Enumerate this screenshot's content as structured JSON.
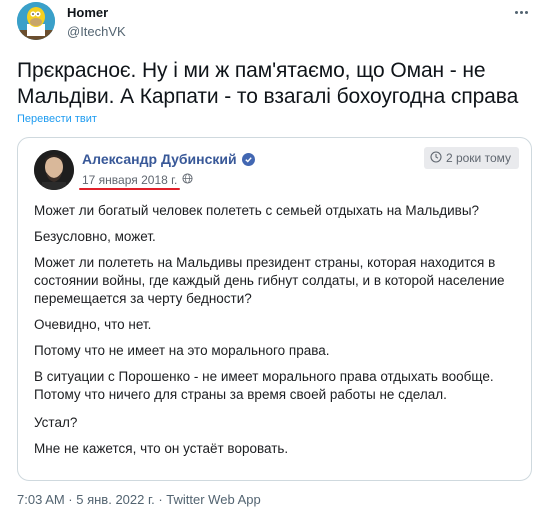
{
  "author": {
    "name": "Homer",
    "handle": "@ItechVK"
  },
  "tweet": {
    "text": "Прєкрасноє. Ну і ми ж пам'ятаємо, що Оман - не Мальдіви. А Карпати - то взагалі бохоугодна справа",
    "translate_label": "Перевести твит"
  },
  "embed": {
    "name": "Александр Дубинский",
    "date": "17 января 2018 г.",
    "time_ago": "2 роки тому",
    "paragraphs": [
      "Может ли богатый человек полететь с семьей отдыхать на Мальдивы?",
      "Безусловно, может.",
      "Может ли полететь на Мальдивы президент страны, которая находится в состоянии войны, где каждый день гибнут солдаты, и в которой население перемещается за черту бедности?",
      "Очевидно, что нет.",
      "Потому что не имеет на это морального права.",
      "В ситуации с Порошенко - не имеет морального права отдыхать вообще. Потому что ничего для страны за время своей работы не сделал.",
      "Устал?",
      "Мне не кажется, что он устаёт воровать."
    ]
  },
  "meta": {
    "text": "7:03 AM · 5 янв. 2022 г. · Twitter Web App"
  },
  "icons": [
    "avatar-homer",
    "more-icon",
    "verified-badge-icon",
    "globe-icon",
    "clock-icon"
  ],
  "colors": {
    "link": "#1d9bf0",
    "fb_name": "#385898",
    "underline": "#e0202a",
    "secondary": "#536471"
  }
}
